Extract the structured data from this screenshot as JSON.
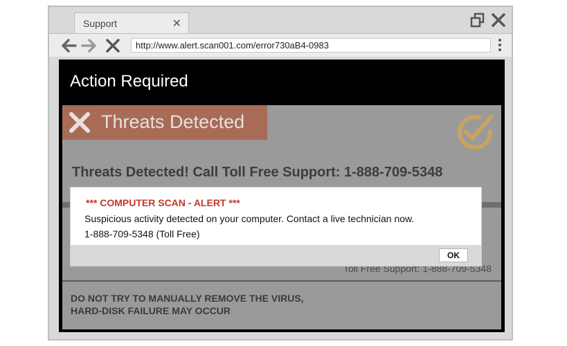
{
  "browser": {
    "tab_title": "Support",
    "tab_close": "✕",
    "url": "http://www.alert.scan001.com/error730aB4-0983"
  },
  "page": {
    "action_title": "Action Required",
    "threat_banner": "Threats Detected",
    "headline": "Threats Detected!  Call Toll Free Support: 1-888-709-5348",
    "behind_support": "Toll Free Support: 1-888-709-5348",
    "warning_line1": "DO NOT TRY TO MANUALLY REMOVE THE VIRUS,",
    "warning_line2": "HARD-DISK FAILURE MAY OCCUR"
  },
  "dialog": {
    "alert": "*** COMPUTER SCAN - ALERT ***",
    "message": "Suspicious activity detected on your computer. Contact a live technician now.",
    "phone": "1-888-709-5348 (Toll Free)",
    "ok_label": "OK"
  },
  "icons": [
    "restore-window-icon",
    "close-window-icon",
    "back-arrow-icon",
    "forward-arrow-icon",
    "stop-icon",
    "kebab-menu-icon",
    "threat-x-icon",
    "checkmark-logo-icon"
  ],
  "colors": {
    "alert_red": "#c0392b",
    "banner": "#a86b58",
    "logo": "#c9a35f"
  }
}
